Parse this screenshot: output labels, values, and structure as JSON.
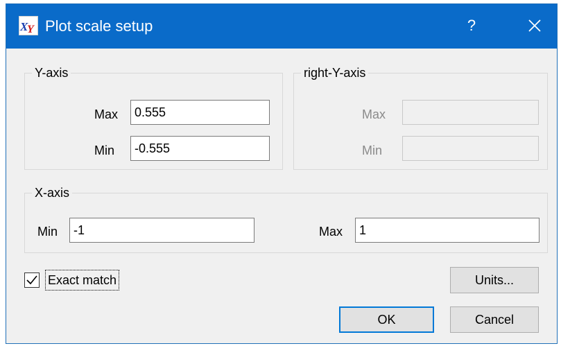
{
  "window": {
    "title": "Plot scale setup",
    "help_label": "?",
    "app_icon": "xy-plot-icon",
    "close_icon": "close-icon"
  },
  "y_axis": {
    "group_label": "Y-axis",
    "max_label": "Max",
    "max_value": "0.555",
    "min_label": "Min",
    "min_value": "-0.555"
  },
  "right_y_axis": {
    "group_label": "right-Y-axis",
    "max_label": "Max",
    "max_value": "",
    "min_label": "Min",
    "min_value": "",
    "enabled": false
  },
  "x_axis": {
    "group_label": "X-axis",
    "min_label": "Min",
    "min_value": "-1",
    "max_label": "Max",
    "max_value": "1"
  },
  "exact_match": {
    "label": "Exact match",
    "checked": true
  },
  "buttons": {
    "units": "Units...",
    "ok": "OK",
    "cancel": "Cancel"
  },
  "colors": {
    "titlebar": "#0a6bc9",
    "dialog_bg": "#f0f0f0",
    "default_button_border": "#0078d7"
  }
}
